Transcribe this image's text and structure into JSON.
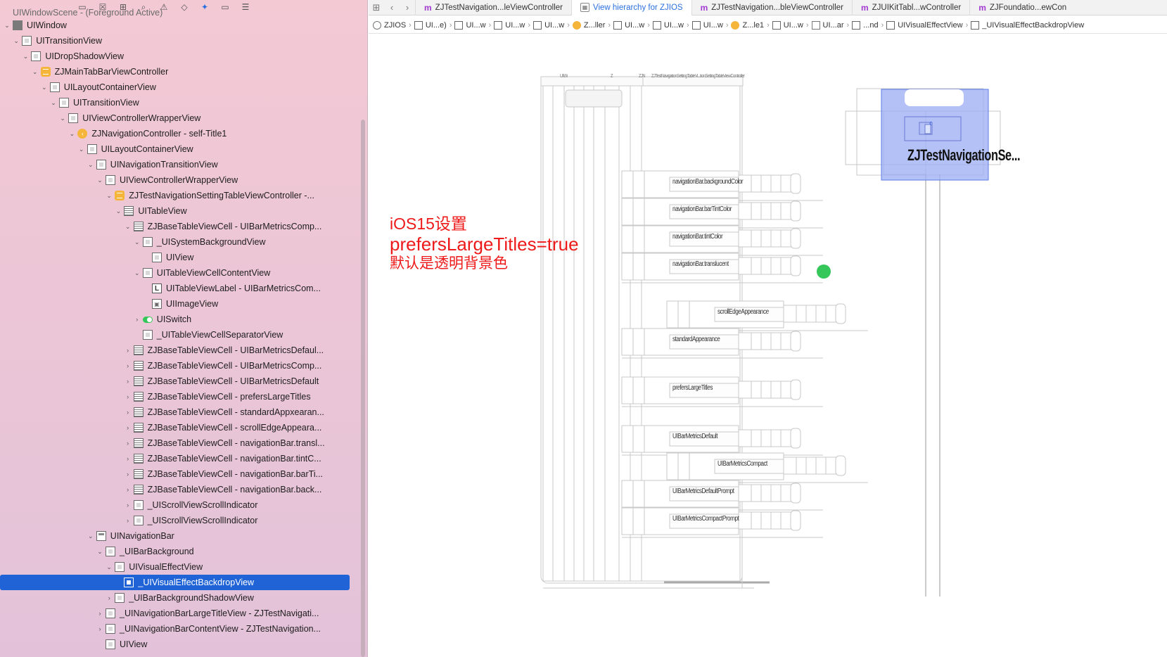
{
  "navigator": {
    "toolbar_icons": [
      "folder-icon",
      "close-square-icon",
      "hierarchy-icon",
      "search-icon",
      "warning-icon",
      "diamond-icon",
      "debug-icon",
      "label-icon",
      "list-icon"
    ],
    "rows": [
      {
        "label": "UIWindowScene - (Foreground Active)",
        "indent": 0,
        "icon": "none",
        "chevron": "",
        "kind": "scene"
      },
      {
        "label": "UIWindow",
        "indent": 0,
        "icon": "window",
        "chevron": "down"
      },
      {
        "label": "UITransitionView",
        "indent": 1,
        "icon": "view",
        "chevron": "down"
      },
      {
        "label": "UIDropShadowView",
        "indent": 2,
        "icon": "view",
        "chevron": "down"
      },
      {
        "label": "ZJMainTabBarViewController",
        "indent": 3,
        "icon": "tctrl",
        "chevron": "down"
      },
      {
        "label": "UILayoutContainerView",
        "indent": 4,
        "icon": "view",
        "chevron": "down"
      },
      {
        "label": "UITransitionView",
        "indent": 5,
        "icon": "view",
        "chevron": "down"
      },
      {
        "label": "UIViewControllerWrapperView",
        "indent": 6,
        "icon": "view",
        "chevron": "down"
      },
      {
        "label": "ZJNavigationController - self-Title1",
        "indent": 7,
        "icon": "controller",
        "chevron": "down"
      },
      {
        "label": "UILayoutContainerView",
        "indent": 8,
        "icon": "view",
        "chevron": "down"
      },
      {
        "label": "UINavigationTransitionView",
        "indent": 9,
        "icon": "view",
        "chevron": "down"
      },
      {
        "label": "UIViewControllerWrapperView",
        "indent": 10,
        "icon": "view",
        "chevron": "down"
      },
      {
        "label": "ZJTestNavigationSettingTableViewController -...",
        "indent": 11,
        "icon": "tctrl",
        "chevron": "down"
      },
      {
        "label": "UITableView",
        "indent": 12,
        "icon": "table",
        "chevron": "down"
      },
      {
        "label": "ZJBaseTableViewCell - UIBarMetricsComp...",
        "indent": 13,
        "icon": "table",
        "chevron": "down"
      },
      {
        "label": "_UISystemBackgroundView",
        "indent": 14,
        "icon": "view",
        "chevron": "down"
      },
      {
        "label": "UIView",
        "indent": 15,
        "icon": "view",
        "chevron": ""
      },
      {
        "label": "UITableViewCellContentView",
        "indent": 14,
        "icon": "view",
        "chevron": "down"
      },
      {
        "label": "UITableViewLabel - UIBarMetricsCom...",
        "indent": 15,
        "icon": "label",
        "chevron": ""
      },
      {
        "label": "UIImageView",
        "indent": 15,
        "icon": "image",
        "chevron": ""
      },
      {
        "label": "UISwitch",
        "indent": 14,
        "icon": "switch",
        "chevron": "right"
      },
      {
        "label": "_UITableViewCellSeparatorView",
        "indent": 14,
        "icon": "view",
        "chevron": ""
      },
      {
        "label": "ZJBaseTableViewCell - UIBarMetricsDefaul...",
        "indent": 13,
        "icon": "table",
        "chevron": "right"
      },
      {
        "label": "ZJBaseTableViewCell - UIBarMetricsComp...",
        "indent": 13,
        "icon": "table",
        "chevron": "right"
      },
      {
        "label": "ZJBaseTableViewCell - UIBarMetricsDefault",
        "indent": 13,
        "icon": "table",
        "chevron": "right"
      },
      {
        "label": "ZJBaseTableViewCell - prefersLargeTitles",
        "indent": 13,
        "icon": "table",
        "chevron": "right"
      },
      {
        "label": "ZJBaseTableViewCell - standardAppxearan...",
        "indent": 13,
        "icon": "table",
        "chevron": "right"
      },
      {
        "label": "ZJBaseTableViewCell - scrollEdgeAppeara...",
        "indent": 13,
        "icon": "table",
        "chevron": "right"
      },
      {
        "label": "ZJBaseTableViewCell - navigationBar.transl...",
        "indent": 13,
        "icon": "table",
        "chevron": "right"
      },
      {
        "label": "ZJBaseTableViewCell - navigationBar.tintC...",
        "indent": 13,
        "icon": "table",
        "chevron": "right"
      },
      {
        "label": "ZJBaseTableViewCell - navigationBar.barTi...",
        "indent": 13,
        "icon": "table",
        "chevron": "right"
      },
      {
        "label": "ZJBaseTableViewCell - navigationBar.back...",
        "indent": 13,
        "icon": "table",
        "chevron": "right"
      },
      {
        "label": "_UIScrollViewScrollIndicator",
        "indent": 13,
        "icon": "view",
        "chevron": "right"
      },
      {
        "label": "_UIScrollViewScrollIndicator",
        "indent": 13,
        "icon": "view",
        "chevron": "right"
      },
      {
        "label": "UINavigationBar",
        "indent": 9,
        "icon": "navbar",
        "chevron": "down"
      },
      {
        "label": "_UIBarBackground",
        "indent": 10,
        "icon": "view",
        "chevron": "down"
      },
      {
        "label": "UIVisualEffectView",
        "indent": 11,
        "icon": "view",
        "chevron": "down"
      },
      {
        "label": "_UIVisualEffectBackdropView",
        "indent": 12,
        "icon": "view",
        "chevron": "",
        "selected": true
      },
      {
        "label": "_UIBarBackgroundShadowView",
        "indent": 11,
        "icon": "view",
        "chevron": "right"
      },
      {
        "label": "_UINavigationBarLargeTitleView - ZJTestNavigati...",
        "indent": 10,
        "icon": "view",
        "chevron": "right"
      },
      {
        "label": "_UINavigationBarContentView - ZJTestNavigation...",
        "indent": 10,
        "icon": "view",
        "chevron": "right"
      },
      {
        "label": "UIView",
        "indent": 10,
        "icon": "view",
        "chevron": ""
      }
    ]
  },
  "tabs": [
    {
      "icon": "m",
      "label": "ZJTestNavigation...leViewController",
      "active": false
    },
    {
      "icon": "hierarchy",
      "label": "View hierarchy for ZJIOS",
      "active": true
    },
    {
      "icon": "m",
      "label": "ZJTestNavigation...bleViewController",
      "active": false
    },
    {
      "icon": "m",
      "label": "ZJUIKitTabl...wController",
      "active": false
    },
    {
      "icon": "m",
      "label": "ZJFoundatio...ewCon",
      "active": false
    }
  ],
  "breadcrumbs": [
    {
      "label": "ZJIOS",
      "icon": "proj"
    },
    {
      "label": "UI...e)",
      "icon": "view"
    },
    {
      "label": "UI...w",
      "icon": "view"
    },
    {
      "label": "UI...w",
      "icon": "view"
    },
    {
      "label": "UI...w",
      "icon": "view"
    },
    {
      "label": "Z...ller",
      "icon": "ctrl"
    },
    {
      "label": "UI...w",
      "icon": "view"
    },
    {
      "label": "UI...w",
      "icon": "view"
    },
    {
      "label": "UI...w",
      "icon": "view"
    },
    {
      "label": "Z...le1",
      "icon": "ctrl"
    },
    {
      "label": "UI...w",
      "icon": "view"
    },
    {
      "label": "UI...ar",
      "icon": "nav"
    },
    {
      "label": "...nd",
      "icon": "view"
    },
    {
      "label": "UIVisualEffectView",
      "icon": "view"
    },
    {
      "label": "_UIVisualEffectBackdropView",
      "icon": "view"
    }
  ],
  "annotation": {
    "line1": "iOS15设置",
    "line2": "prefersLargeTitles=true",
    "line3": "默认是透明背景色"
  },
  "canvas": {
    "header_labels": [
      "UIWi",
      "Z",
      "ZJN",
      "ZJTestNavigationSettingTableVi...tionSettingTableViewController"
    ],
    "nav_title": "ZJTestNavigationSe...",
    "back_glyph": "‹",
    "cell_labels": [
      "navigationBar.backgroundColor",
      "navigationBar.barTintColor",
      "navigationBar.tintColor",
      "navigationBar.translucent",
      "scrollEdgeAppearance",
      "standardAppearance",
      "prefersLargeTitles",
      "UIBarMetricsDefault",
      "UIBarMetricsCompact",
      "UIBarMetricsDefaultPrompt",
      "UIBarMetricsCompactPrompt"
    ],
    "switch_color": "#35c759",
    "selection_color": "#9fb0f5"
  },
  "colors": {
    "accent": "#2a6fe0",
    "selection": "#1f63d6",
    "annotation": "#ee1a1a"
  }
}
